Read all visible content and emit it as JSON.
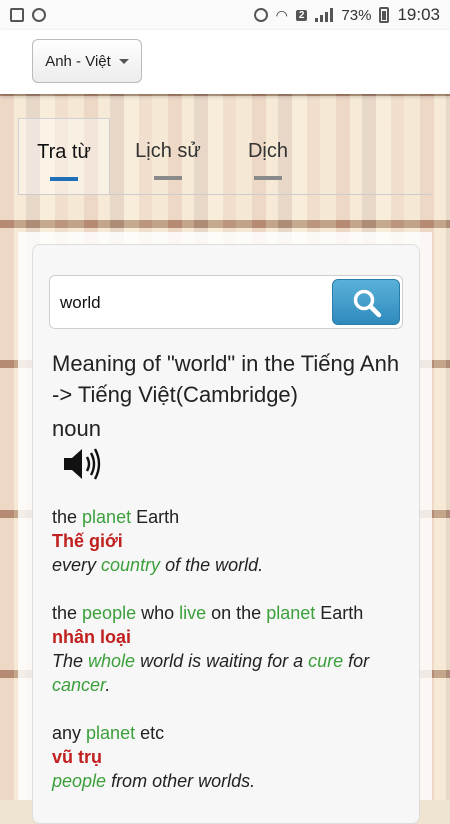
{
  "status_bar": {
    "battery": "73%",
    "time": "19:03",
    "sim": "2"
  },
  "appbar": {
    "language": "Anh - Việt"
  },
  "tabs": [
    {
      "label": "Tra từ",
      "active": true
    },
    {
      "label": "Lịch sử",
      "active": false
    },
    {
      "label": "Dịch",
      "active": false
    }
  ],
  "search": {
    "value": "world"
  },
  "result": {
    "title": "Meaning of \"world\" in the Tiếng Anh -> Tiếng Việt(Cambridge)",
    "part_of_speech": "noun"
  },
  "entries": [
    {
      "definition": [
        {
          "t": "the "
        },
        {
          "t": "planet",
          "hl": true
        },
        {
          "t": " Earth"
        }
      ],
      "translation": "Thế giới",
      "example": [
        {
          "t": "every "
        },
        {
          "t": "country",
          "hl": true
        },
        {
          "t": " of the world."
        }
      ]
    },
    {
      "definition": [
        {
          "t": "the "
        },
        {
          "t": "people",
          "hl": true
        },
        {
          "t": " who "
        },
        {
          "t": "live",
          "hl": true
        },
        {
          "t": " on the "
        },
        {
          "t": "planet",
          "hl": true
        },
        {
          "t": " Earth"
        }
      ],
      "translation": "nhân loại",
      "example": [
        {
          "t": "The "
        },
        {
          "t": "whole",
          "hl": true
        },
        {
          "t": " world is waiting for a "
        },
        {
          "t": "cure",
          "hl": true
        },
        {
          "t": " for "
        },
        {
          "t": "cancer",
          "hl": true
        },
        {
          "t": "."
        }
      ]
    },
    {
      "definition": [
        {
          "t": "any "
        },
        {
          "t": "planet",
          "hl": true
        },
        {
          "t": " etc"
        }
      ],
      "translation": "vũ trụ",
      "example": [
        {
          "t": "people",
          "hl": true
        },
        {
          "t": " from other worlds."
        }
      ]
    }
  ],
  "colors": {
    "highlight": "#3ba03b",
    "translation": "#c0201f",
    "tab_active": "#1f6fb8",
    "search_button": "#3a97c8"
  }
}
